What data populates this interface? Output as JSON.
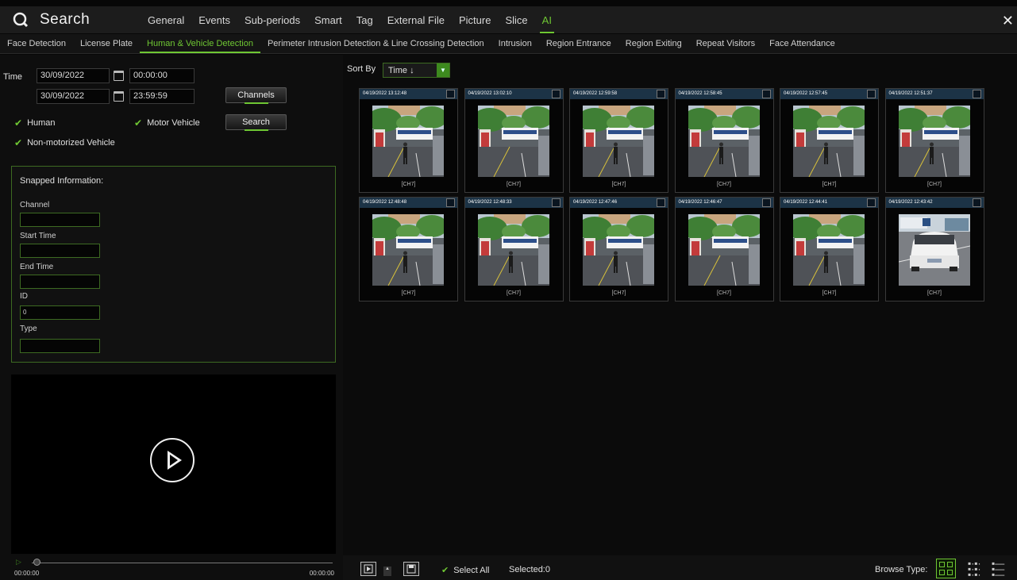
{
  "header": {
    "title": "Search",
    "close_label": "✕",
    "tabs": [
      "General",
      "Events",
      "Sub-periods",
      "Smart",
      "Tag",
      "External File",
      "Picture",
      "Slice",
      "AI"
    ],
    "active_tab": "AI"
  },
  "subtabs": [
    "Face Detection",
    "License Plate",
    "Human & Vehicle Detection",
    "Perimeter Intrusion Detection & Line Crossing Detection",
    "Intrusion",
    "Region Entrance",
    "Region Exiting",
    "Repeat Visitors",
    "Face Attendance"
  ],
  "filters": {
    "time_label": "Time",
    "start_date": "30/09/2022",
    "start_time": "00:00:00",
    "end_date": "30/09/2022",
    "end_time": "23:59:59",
    "channels_button": "Channels",
    "search_button": "Search",
    "checks": {
      "human": "Human",
      "motor": "Motor Vehicle",
      "nonmotor": "Non-motorized Vehicle"
    }
  },
  "snapped": {
    "title": "Snapped Information:",
    "channel_label": "Channel",
    "channel_value": "",
    "start_label": "Start Time",
    "start_value": "",
    "end_label": "End Time",
    "end_value": "",
    "id_label": "ID",
    "id_value": "0",
    "type_label": "Type",
    "type_value": ""
  },
  "player": {
    "time_start": "00:00:00",
    "time_end": "00:00:00"
  },
  "sort": {
    "label": "Sort By",
    "value": "Time ↓"
  },
  "results": [
    {
      "ts": "04/19/2022 13:12:48",
      "ch": "[CH7]",
      "scene": "person"
    },
    {
      "ts": "04/19/2022 13:02:10",
      "ch": "[CH7]",
      "scene": "empty"
    },
    {
      "ts": "04/19/2022 12:59:58",
      "ch": "[CH7]",
      "scene": "person"
    },
    {
      "ts": "04/19/2022 12:58:45",
      "ch": "[CH7]",
      "scene": "person"
    },
    {
      "ts": "04/19/2022 12:57:45",
      "ch": "[CH7]",
      "scene": "person"
    },
    {
      "ts": "04/19/2022 12:51:37",
      "ch": "[CH7]",
      "scene": "person"
    },
    {
      "ts": "04/19/2022 12:48:48",
      "ch": "[CH7]",
      "scene": "person"
    },
    {
      "ts": "04/19/2022 12:48:33",
      "ch": "[CH7]",
      "scene": "person"
    },
    {
      "ts": "04/19/2022 12:47:46",
      "ch": "[CH7]",
      "scene": "person"
    },
    {
      "ts": "04/19/2022 12:46:47",
      "ch": "[CH7]",
      "scene": "empty"
    },
    {
      "ts": "04/19/2022 12:44:41",
      "ch": "[CH7]",
      "scene": "person"
    },
    {
      "ts": "04/19/2022 12:43:42",
      "ch": "[CH7]",
      "scene": "car"
    }
  ],
  "footer": {
    "select_all": "Select All",
    "selected": "Selected:0",
    "browse_type": "Browse Type:"
  },
  "colors": {
    "accent": "#6fc733",
    "header_bg": "#1c1c1c",
    "card_header": "#1c3346"
  }
}
